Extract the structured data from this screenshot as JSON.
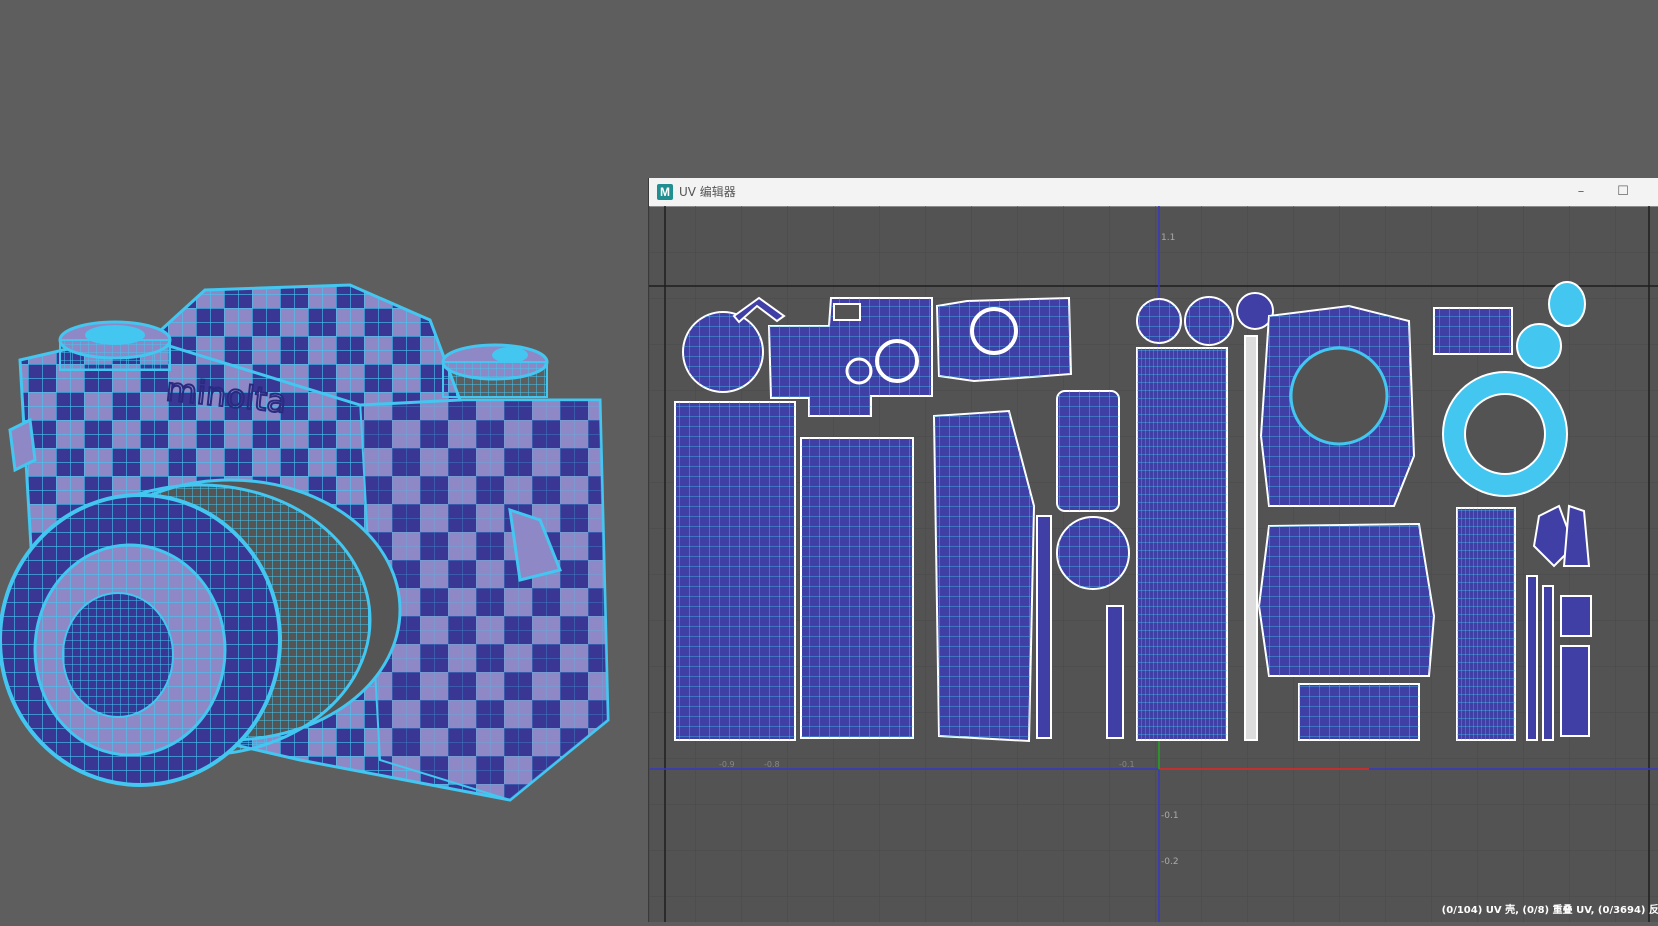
{
  "window": {
    "app_icon": "M",
    "title": "UV 编辑器",
    "minimize_symbol": "–",
    "maximize_symbol": "☐"
  },
  "uv_axis_labels": {
    "v_top": "1.1",
    "v_neg1": "-0.1",
    "v_neg2": "-0.2",
    "u_neg9": "-0.9",
    "u_neg8": "-0.8",
    "u_neg1": "-0.1"
  },
  "status": {
    "text": "(0/104) UV 壳, (0/8) 重叠 UV, (0/3694) 反"
  },
  "colors": {
    "viewport_bg": "#5e5e5e",
    "uv_bg": "#535353",
    "uv_fill": "#3f3fa6",
    "uv_wire": "#43c6f0",
    "checker_light": "#8f88c6",
    "checker_dark": "#3a3794",
    "axis_blue": "#3838c8",
    "axis_red": "#c03030",
    "axis_green": "#2f8f2f"
  }
}
